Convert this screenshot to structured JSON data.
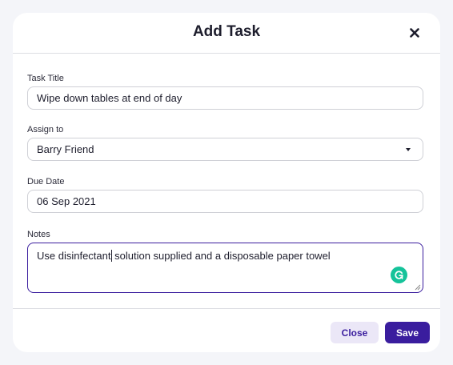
{
  "dialog": {
    "title": "Add Task"
  },
  "form": {
    "task_title": {
      "label": "Task Title",
      "value": "Wipe down tables at end of day"
    },
    "assign_to": {
      "label": "Assign to",
      "value": "Barry Friend"
    },
    "due_date": {
      "label": "Due Date",
      "value": "06 Sep 2021"
    },
    "notes": {
      "label": "Notes",
      "value_before_cursor": "Use disinfectant",
      "value_after_cursor": " solution supplied and a disposable paper towel"
    }
  },
  "footer": {
    "close_label": "Close",
    "save_label": "Save"
  },
  "icons": {
    "close": "close-icon",
    "dropdown": "chevron-down-icon",
    "grammarly": "grammarly-icon",
    "resize": "resize-handle-icon"
  },
  "colors": {
    "primary": "#3a1d9e",
    "secondary_bg": "#ebe7f7",
    "grammarly": "#15c39a"
  }
}
